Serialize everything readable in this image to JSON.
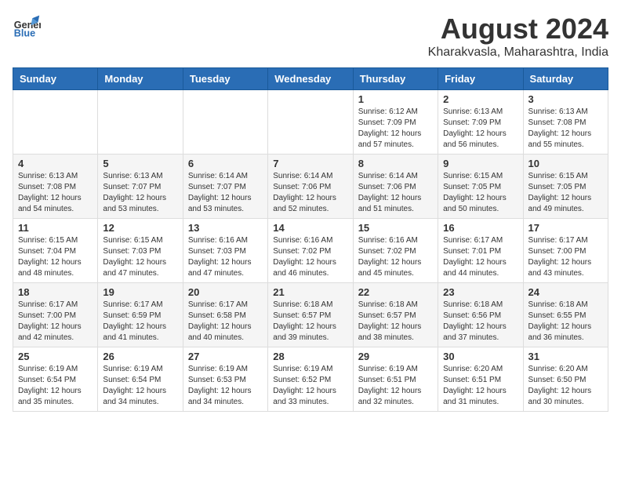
{
  "logo": {
    "name_line1": "General",
    "name_line2": "Blue"
  },
  "title": "August 2024",
  "subtitle": "Kharakvasla, Maharashtra, India",
  "days_of_week": [
    "Sunday",
    "Monday",
    "Tuesday",
    "Wednesday",
    "Thursday",
    "Friday",
    "Saturday"
  ],
  "weeks": [
    [
      {
        "day": "",
        "info": ""
      },
      {
        "day": "",
        "info": ""
      },
      {
        "day": "",
        "info": ""
      },
      {
        "day": "",
        "info": ""
      },
      {
        "day": "1",
        "info": "Sunrise: 6:12 AM\nSunset: 7:09 PM\nDaylight: 12 hours\nand 57 minutes."
      },
      {
        "day": "2",
        "info": "Sunrise: 6:13 AM\nSunset: 7:09 PM\nDaylight: 12 hours\nand 56 minutes."
      },
      {
        "day": "3",
        "info": "Sunrise: 6:13 AM\nSunset: 7:08 PM\nDaylight: 12 hours\nand 55 minutes."
      }
    ],
    [
      {
        "day": "4",
        "info": "Sunrise: 6:13 AM\nSunset: 7:08 PM\nDaylight: 12 hours\nand 54 minutes."
      },
      {
        "day": "5",
        "info": "Sunrise: 6:13 AM\nSunset: 7:07 PM\nDaylight: 12 hours\nand 53 minutes."
      },
      {
        "day": "6",
        "info": "Sunrise: 6:14 AM\nSunset: 7:07 PM\nDaylight: 12 hours\nand 53 minutes."
      },
      {
        "day": "7",
        "info": "Sunrise: 6:14 AM\nSunset: 7:06 PM\nDaylight: 12 hours\nand 52 minutes."
      },
      {
        "day": "8",
        "info": "Sunrise: 6:14 AM\nSunset: 7:06 PM\nDaylight: 12 hours\nand 51 minutes."
      },
      {
        "day": "9",
        "info": "Sunrise: 6:15 AM\nSunset: 7:05 PM\nDaylight: 12 hours\nand 50 minutes."
      },
      {
        "day": "10",
        "info": "Sunrise: 6:15 AM\nSunset: 7:05 PM\nDaylight: 12 hours\nand 49 minutes."
      }
    ],
    [
      {
        "day": "11",
        "info": "Sunrise: 6:15 AM\nSunset: 7:04 PM\nDaylight: 12 hours\nand 48 minutes."
      },
      {
        "day": "12",
        "info": "Sunrise: 6:15 AM\nSunset: 7:03 PM\nDaylight: 12 hours\nand 47 minutes."
      },
      {
        "day": "13",
        "info": "Sunrise: 6:16 AM\nSunset: 7:03 PM\nDaylight: 12 hours\nand 47 minutes."
      },
      {
        "day": "14",
        "info": "Sunrise: 6:16 AM\nSunset: 7:02 PM\nDaylight: 12 hours\nand 46 minutes."
      },
      {
        "day": "15",
        "info": "Sunrise: 6:16 AM\nSunset: 7:02 PM\nDaylight: 12 hours\nand 45 minutes."
      },
      {
        "day": "16",
        "info": "Sunrise: 6:17 AM\nSunset: 7:01 PM\nDaylight: 12 hours\nand 44 minutes."
      },
      {
        "day": "17",
        "info": "Sunrise: 6:17 AM\nSunset: 7:00 PM\nDaylight: 12 hours\nand 43 minutes."
      }
    ],
    [
      {
        "day": "18",
        "info": "Sunrise: 6:17 AM\nSunset: 7:00 PM\nDaylight: 12 hours\nand 42 minutes."
      },
      {
        "day": "19",
        "info": "Sunrise: 6:17 AM\nSunset: 6:59 PM\nDaylight: 12 hours\nand 41 minutes."
      },
      {
        "day": "20",
        "info": "Sunrise: 6:17 AM\nSunset: 6:58 PM\nDaylight: 12 hours\nand 40 minutes."
      },
      {
        "day": "21",
        "info": "Sunrise: 6:18 AM\nSunset: 6:57 PM\nDaylight: 12 hours\nand 39 minutes."
      },
      {
        "day": "22",
        "info": "Sunrise: 6:18 AM\nSunset: 6:57 PM\nDaylight: 12 hours\nand 38 minutes."
      },
      {
        "day": "23",
        "info": "Sunrise: 6:18 AM\nSunset: 6:56 PM\nDaylight: 12 hours\nand 37 minutes."
      },
      {
        "day": "24",
        "info": "Sunrise: 6:18 AM\nSunset: 6:55 PM\nDaylight: 12 hours\nand 36 minutes."
      }
    ],
    [
      {
        "day": "25",
        "info": "Sunrise: 6:19 AM\nSunset: 6:54 PM\nDaylight: 12 hours\nand 35 minutes."
      },
      {
        "day": "26",
        "info": "Sunrise: 6:19 AM\nSunset: 6:54 PM\nDaylight: 12 hours\nand 34 minutes."
      },
      {
        "day": "27",
        "info": "Sunrise: 6:19 AM\nSunset: 6:53 PM\nDaylight: 12 hours\nand 34 minutes."
      },
      {
        "day": "28",
        "info": "Sunrise: 6:19 AM\nSunset: 6:52 PM\nDaylight: 12 hours\nand 33 minutes."
      },
      {
        "day": "29",
        "info": "Sunrise: 6:19 AM\nSunset: 6:51 PM\nDaylight: 12 hours\nand 32 minutes."
      },
      {
        "day": "30",
        "info": "Sunrise: 6:20 AM\nSunset: 6:51 PM\nDaylight: 12 hours\nand 31 minutes."
      },
      {
        "day": "31",
        "info": "Sunrise: 6:20 AM\nSunset: 6:50 PM\nDaylight: 12 hours\nand 30 minutes."
      }
    ]
  ]
}
